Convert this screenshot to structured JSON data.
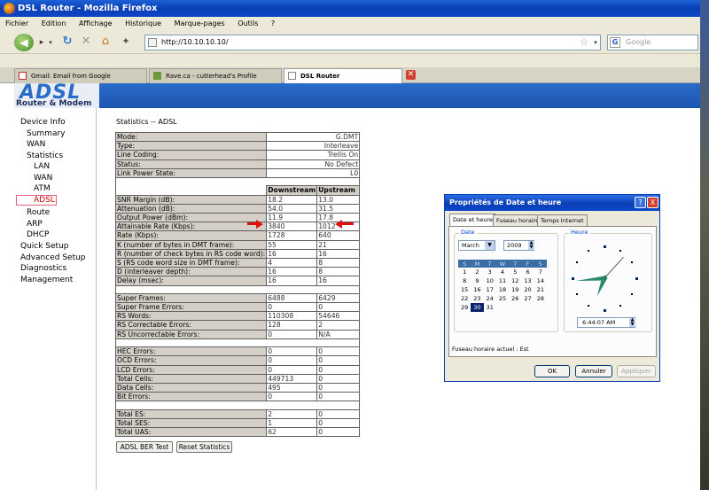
{
  "browser": {
    "title": "DSL Router - Mozilla Firefox",
    "menu": [
      "Fichier",
      "Edition",
      "Affichage",
      "Historique",
      "Marque-pages",
      "Outils",
      "?"
    ],
    "url": "http://10.10.10.10/",
    "search_placeholder": "Google",
    "search_engine_glyph": "G",
    "tabs": [
      {
        "label": "Gmail: Email from Google",
        "active": false
      },
      {
        "label": "Rave.ca - cutterhead's Profile",
        "active": false
      },
      {
        "label": "DSL Router",
        "active": true
      }
    ]
  },
  "router": {
    "logo_main": "ADSL",
    "logo_sub": "Router & Modem",
    "nav": [
      {
        "label": "Device Info",
        "level": 0
      },
      {
        "label": "Summary",
        "level": 1
      },
      {
        "label": "WAN",
        "level": 1
      },
      {
        "label": "Statistics",
        "level": 1
      },
      {
        "label": "LAN",
        "level": 2
      },
      {
        "label": "WAN",
        "level": 2
      },
      {
        "label": "ATM",
        "level": 2
      },
      {
        "label": "ADSL",
        "level": 2,
        "selected": true
      },
      {
        "label": "Route",
        "level": 1
      },
      {
        "label": "ARP",
        "level": 1
      },
      {
        "label": "DHCP",
        "level": 1
      },
      {
        "label": "Quick Setup",
        "level": 0
      },
      {
        "label": "Advanced Setup",
        "level": 0
      },
      {
        "label": "Diagnostics",
        "level": 0
      },
      {
        "label": "Management",
        "level": 0
      }
    ],
    "page_title": "Statistics -- ADSL",
    "info_rows": [
      {
        "label": "Mode:",
        "value": "G.DMT"
      },
      {
        "label": "Type:",
        "value": "Interleave"
      },
      {
        "label": "Line Coding:",
        "value": "Trellis On"
      },
      {
        "label": "Status:",
        "value": "No Defect"
      },
      {
        "label": "Link Power State:",
        "value": "L0"
      }
    ],
    "col_downstream": "Downstream",
    "col_upstream": "Upstream",
    "line_rows": [
      {
        "label": "SNR Margin (dB):",
        "down": "18.2",
        "up": "13.0"
      },
      {
        "label": "Attenuation (dB):",
        "down": "54.0",
        "up": "31.5"
      },
      {
        "label": "Output Power (dBm):",
        "down": "11.9",
        "up": "17.8"
      },
      {
        "label": "Attainable Rate (Kbps):",
        "down": "3840",
        "up": "1012"
      }
    ],
    "rate_rows": [
      {
        "label": "Rate (Kbps):",
        "down": "1728",
        "up": "640"
      }
    ],
    "frame_param_rows": [
      {
        "label": "K (number of bytes in DMT frame):",
        "down": "55",
        "up": "21"
      },
      {
        "label": "R (number of check bytes in RS code word):",
        "down": "16",
        "up": "16"
      },
      {
        "label": "S (RS code word size in DMT frame):",
        "down": "4",
        "up": "8"
      },
      {
        "label": "D (interleaver depth):",
        "down": "16",
        "up": "8"
      },
      {
        "label": "Delay (msec):",
        "down": "16",
        "up": "16"
      }
    ],
    "frame_rows": [
      {
        "label": "Super Frames:",
        "down": "6488",
        "up": "6429"
      },
      {
        "label": "Super Frame Errors:",
        "down": "0",
        "up": "0"
      },
      {
        "label": "RS Words:",
        "down": "110308",
        "up": "54646"
      },
      {
        "label": "RS Correctable Errors:",
        "down": "128",
        "up": "2"
      },
      {
        "label": "RS Uncorrectable Errors:",
        "down": "0",
        "up": "N/A"
      }
    ],
    "cell_rows": [
      {
        "label": "HEC Errors:",
        "down": "0",
        "up": "0"
      },
      {
        "label": "OCD Errors:",
        "down": "0",
        "up": "0"
      },
      {
        "label": "LCD Errors:",
        "down": "0",
        "up": "0"
      },
      {
        "label": "Total Cells:",
        "down": "449713",
        "up": "0"
      },
      {
        "label": "Data Cells:",
        "down": "495",
        "up": "0"
      },
      {
        "label": "Bit Errors:",
        "down": "0",
        "up": "0"
      }
    ],
    "total_rows": [
      {
        "label": "Total ES:",
        "down": "2",
        "up": "0"
      },
      {
        "label": "Total SES:",
        "down": "1",
        "up": "0"
      },
      {
        "label": "Total UAS:",
        "down": "62",
        "up": "0"
      }
    ],
    "btn_ber": "ADSL BER Test",
    "btn_reset": "Reset Statistics"
  },
  "dialog": {
    "title": "Propriétés de Date et heure",
    "help_glyph": "?",
    "close_glyph": "X",
    "tabs": [
      "Date et heure",
      "Fuseau horaire",
      "Temps Internet"
    ],
    "date_group": "Date",
    "time_group": "Heure",
    "month": "March",
    "year": "2009",
    "weekdays": [
      "S",
      "M",
      "T",
      "W",
      "T",
      "F",
      "S"
    ],
    "weeks": [
      [
        "1",
        "2",
        "3",
        "4",
        "5",
        "6",
        "7"
      ],
      [
        "8",
        "9",
        "10",
        "11",
        "12",
        "13",
        "14"
      ],
      [
        "15",
        "16",
        "17",
        "18",
        "19",
        "20",
        "21"
      ],
      [
        "22",
        "23",
        "24",
        "25",
        "26",
        "27",
        "28"
      ],
      [
        "29",
        "30",
        "31",
        "",
        "",
        "",
        ""
      ]
    ],
    "selected_day": "30",
    "time": "6:44:07 AM",
    "clock_time": {
      "hour": 6,
      "minute": 44,
      "second": 7
    },
    "timezone_text": "Fuseau horaire actuel : Est",
    "btn_ok": "OK",
    "btn_cancel": "Annuler",
    "btn_apply": "Appliquer"
  },
  "colors": {
    "header_blue": "#1a55b0",
    "arrow_red": "#e01010",
    "dialog_title": "#0a3fb4"
  }
}
